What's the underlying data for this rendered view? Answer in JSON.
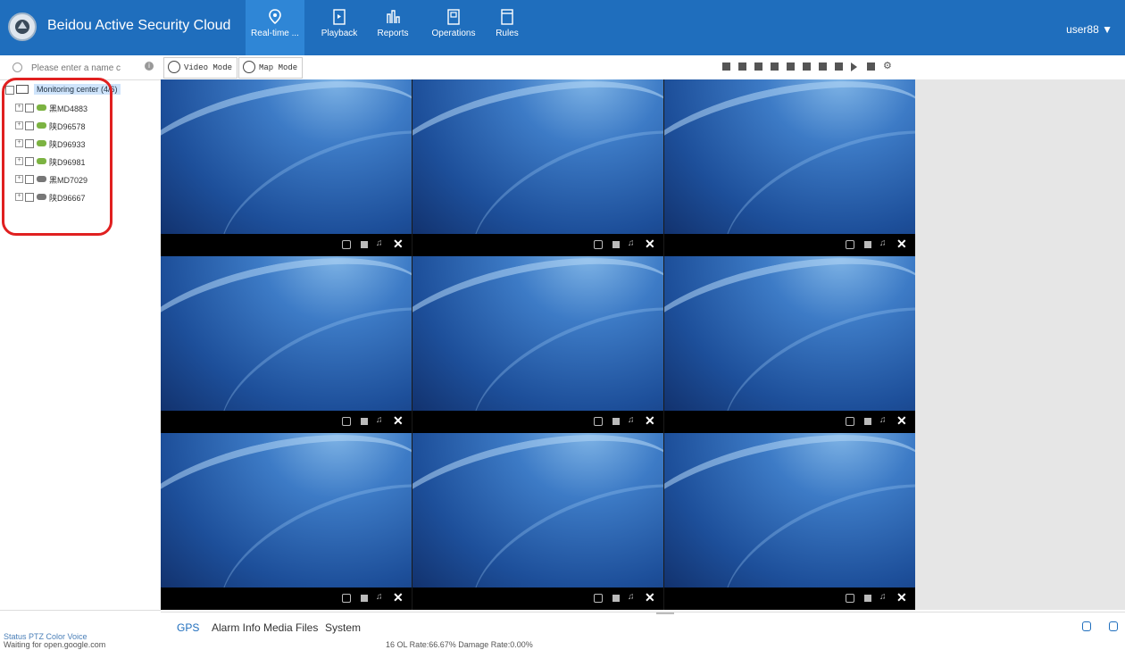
{
  "app": {
    "title": "Beidou Active Security Cloud Platform",
    "user": "user88"
  },
  "nav": [
    {
      "label": "Real-time ...",
      "icon": "location-pin-icon"
    },
    {
      "label": "Playback",
      "icon": "playback-icon"
    },
    {
      "label": "Reports",
      "icon": "reports-icon"
    },
    {
      "label": "Operations",
      "icon": "operations-icon"
    },
    {
      "label": "Rules",
      "icon": "rules-icon"
    }
  ],
  "search": {
    "placeholder": "Please enter a name c"
  },
  "tree": {
    "root": {
      "label": "Monitoring center (4/6)"
    },
    "vehicles": [
      {
        "label": "黑MD4883",
        "online": true
      },
      {
        "label": "陕D96578",
        "online": true
      },
      {
        "label": "陕D96933",
        "online": true
      },
      {
        "label": "陕D96981",
        "online": true
      },
      {
        "label": "黑MD7029",
        "online": false
      },
      {
        "label": "陕D96667",
        "online": false
      }
    ]
  },
  "modes": {
    "video": "Video Mode",
    "map": "Map Mode"
  },
  "video_grid": {
    "rows": 3,
    "cols": 3,
    "selected_index": 4
  },
  "bottom_tabs": [
    "GPS",
    "Alarm Info",
    "Media Files",
    "System"
  ],
  "status": {
    "text": "Status  PTZ  Color  Voice",
    "waiting": "Waiting for open.google.com",
    "rates": "16   OL Rate:66.67%   Damage Rate:0.00%"
  },
  "colors": {
    "topbar": "#1f6ebd",
    "online": "#7cb342",
    "offline": "#777777",
    "highlight": "#e02020"
  }
}
